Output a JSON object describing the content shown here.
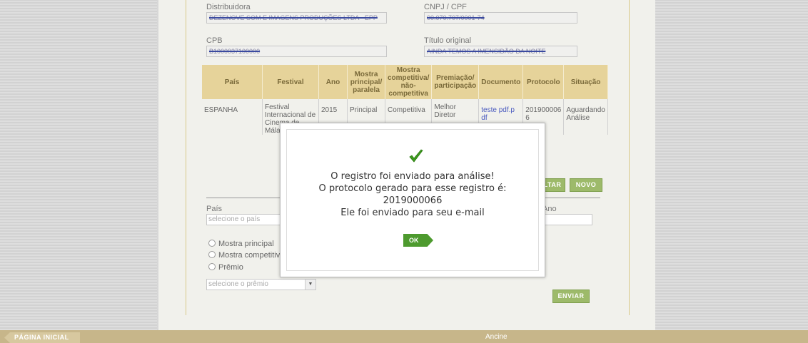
{
  "form": {
    "distributor_label": "Distribuidora",
    "distributor_value": "DEZENOVE SOM E IMAGENS PRODUÇÕES LTDA - EPP",
    "cnpj_label": "CNPJ / CPF",
    "cnpj_value": "00.070.707/0001-74",
    "cpb_label": "CPB",
    "cpb_value": "B1000037100000",
    "title_label": "Título original",
    "title_value": "AINDA TEMOS A IMENSIDÃO DA NOITE"
  },
  "table": {
    "headers": [
      "País",
      "Festival",
      "Ano",
      "Mostra principal/ paralela",
      "Mostra competitiva/ não-competitiva",
      "Premiação/ participação",
      "Documento",
      "Protocolo",
      "Situação"
    ],
    "rows": [
      {
        "pais": "ESPANHA",
        "festival": "Festival Internacional de Cinema de Mála",
        "ano": "2015",
        "mostra": "Principal",
        "competitiva": "Competitiva",
        "premiacao": "Melhor Diretor",
        "documento": "teste pdf.p df",
        "protocolo": "201900006 6",
        "situacao": "Aguardando Análise"
      }
    ]
  },
  "buttons": {
    "voltar": "VOLTAR",
    "novo": "NOVO",
    "enviar": "ENVIAR",
    "ok": "OK",
    "home": "PÁGINA INICIAL"
  },
  "lower_form": {
    "pais_label": "País",
    "pais_placeholder": "selecione o país",
    "ano_label": "Ano",
    "radio_principal": "Mostra principal",
    "radio_competitiva": "Mostra competitiva",
    "radio_premio": "Prêmio",
    "premio_placeholder": "selecione o prêmio"
  },
  "modal": {
    "line1": "O registro foi enviado para análise!",
    "line2": "O protocolo gerado para esse registro é:",
    "line3": "2019000066",
    "line4": "Ele foi enviado para seu e-mail"
  },
  "footer": {
    "center": "Ancine"
  },
  "colors": {
    "accent_green": "#4d9a2e",
    "header_gold": "#e6d39a",
    "footer_bar": "#c7b68a"
  }
}
